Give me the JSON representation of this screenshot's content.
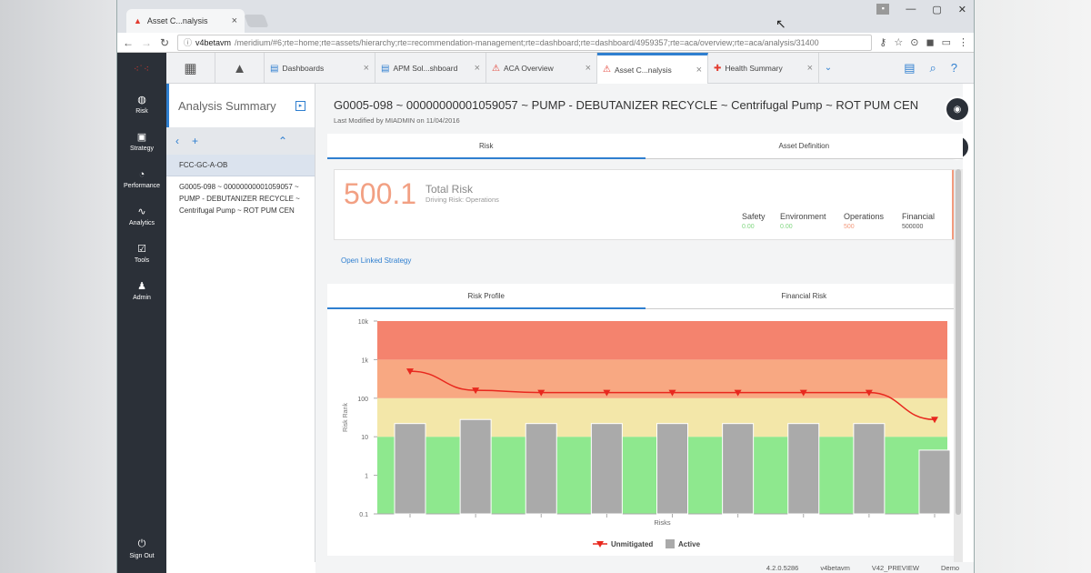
{
  "browser": {
    "tab_title": "Asset C...nalysis",
    "url_host": "v4betavm",
    "url_path": "/meridium/#6;rte=home;rte=assets/hierarchy;rte=recommendation-management;rte=dashboard;rte=dashboard/4959357;rte=aca/overview;rte=aca/analysis/31400"
  },
  "nav": {
    "items": [
      {
        "label": "Risk",
        "icon": "risk-icon"
      },
      {
        "label": "Strategy",
        "icon": "strategy-icon"
      },
      {
        "label": "Performance",
        "icon": "performance-icon"
      },
      {
        "label": "Analytics",
        "icon": "analytics-icon"
      },
      {
        "label": "Tools",
        "icon": "tools-icon"
      },
      {
        "label": "Admin",
        "icon": "admin-icon"
      }
    ],
    "signout": "Sign Out"
  },
  "tabs": [
    {
      "label": "Dashboards"
    },
    {
      "label": "APM Sol...shboard"
    },
    {
      "label": "ACA Overview"
    },
    {
      "label": "Asset C...nalysis"
    },
    {
      "label": "Health Summary"
    }
  ],
  "summary": {
    "title": "Analysis Summary",
    "tree": [
      "FCC-GC-A-OB",
      "G0005-098 ~ 00000000001059057 ~ PUMP - DEBUTANIZER RECYCLE ~ Centrifugal Pump ~ ROT PUM CEN"
    ]
  },
  "asset": {
    "title": "G0005-098 ~ 00000000001059057 ~ PUMP - DEBUTANIZER RECYCLE ~ Centrifugal Pump ~ ROT PUM CEN",
    "modified": "Last Modified by MIADMIN on 11/04/2016"
  },
  "tabs_top": [
    "Risk",
    "Asset Definition"
  ],
  "risk": {
    "value": "500.1",
    "label": "Total Risk",
    "sub": "Driving Risk: Operations",
    "categories": [
      {
        "name": "Safety",
        "value": "0.00",
        "color": "#7fd67f"
      },
      {
        "name": "Environment",
        "value": "0.00",
        "color": "#7fd67f"
      },
      {
        "name": "Operations",
        "value": "500",
        "color": "#f29a7d"
      },
      {
        "name": "Financial",
        "value": "500000",
        "color": "#555555"
      }
    ]
  },
  "open_linked": "Open Linked Strategy",
  "tabs_chart": [
    "Risk Profile",
    "Financial Risk"
  ],
  "status": [
    "4.2.0.5286",
    "v4betavm",
    "V42_PREVIEW",
    "Demo"
  ],
  "chart_data": {
    "type": "bar",
    "title": "",
    "xlabel": "Risks",
    "ylabel": "Risk Rank",
    "yscale": "log",
    "ylim": [
      0.1,
      10000
    ],
    "y_ticks": [
      "10k",
      "1k",
      "100",
      "10",
      "1",
      "0.1"
    ],
    "bands": [
      {
        "from": 0.1,
        "to": 10,
        "color": "#8ee88e"
      },
      {
        "from": 10,
        "to": 100,
        "color": "#f3e7a9"
      },
      {
        "from": 100,
        "to": 1000,
        "color": "#f8a882"
      },
      {
        "from": 1000,
        "to": 10000,
        "color": "#f4836e"
      }
    ],
    "series": [
      {
        "name": "Unmitigated",
        "type": "line",
        "color": "#e8281e",
        "values": [
          500,
          160,
          140,
          140,
          140,
          140,
          140,
          140,
          28
        ]
      },
      {
        "name": "Active",
        "type": "bar",
        "color": "#aaaaaa",
        "values": [
          22,
          28,
          22,
          22,
          22,
          22,
          22,
          22,
          4.5
        ]
      }
    ],
    "legend": "bottom"
  }
}
